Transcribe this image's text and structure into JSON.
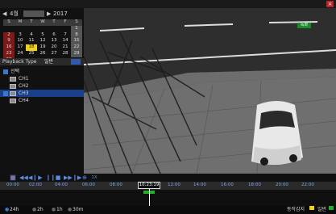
{
  "calendar": {
    "month": "4월",
    "year": "2017",
    "weekdays": [
      "S",
      "M",
      "T",
      "W",
      "T",
      "F",
      "S"
    ],
    "weeks": [
      [
        "",
        "",
        "",
        "",
        "",
        "",
        "1"
      ],
      [
        "2",
        "3",
        "4",
        "5",
        "6",
        "7",
        "8"
      ],
      [
        "9",
        "10",
        "11",
        "12",
        "13",
        "14",
        "15"
      ],
      [
        "16",
        "17",
        "18",
        "19",
        "20",
        "21",
        "22"
      ],
      [
        "23",
        "24",
        "25",
        "26",
        "27",
        "28",
        "29"
      ],
      [
        "30",
        "",
        "",
        "",
        "",
        "",
        ""
      ]
    ],
    "selected_day": "18"
  },
  "playback": {
    "label": "Playback Type",
    "value": "일반"
  },
  "tree": {
    "root": "선택",
    "channels": [
      "CH1",
      "CH2",
      "CH3",
      "CH4"
    ],
    "selected": "CH3"
  },
  "video": {
    "badge": "녹화"
  },
  "controls": {
    "extra_label": "1X"
  },
  "timeline": {
    "ticks": [
      "00:00",
      "02:00",
      "04:00",
      "06:00",
      "08:00",
      "12:00",
      "14:00",
      "16:00",
      "18:00",
      "20:00",
      "22:00"
    ],
    "cursor_time": "10:23:19"
  },
  "bottom": {
    "zoom_options": [
      "24h",
      "2h",
      "1h",
      "30m"
    ],
    "legend": [
      {
        "label": "동작감지",
        "color": "#f0d21a"
      },
      {
        "label": "일반",
        "color": "#22b02a"
      }
    ]
  },
  "colors": {
    "accent": "#3c78c8",
    "selected_day": "#f0d21a",
    "record": "#22b02a"
  }
}
